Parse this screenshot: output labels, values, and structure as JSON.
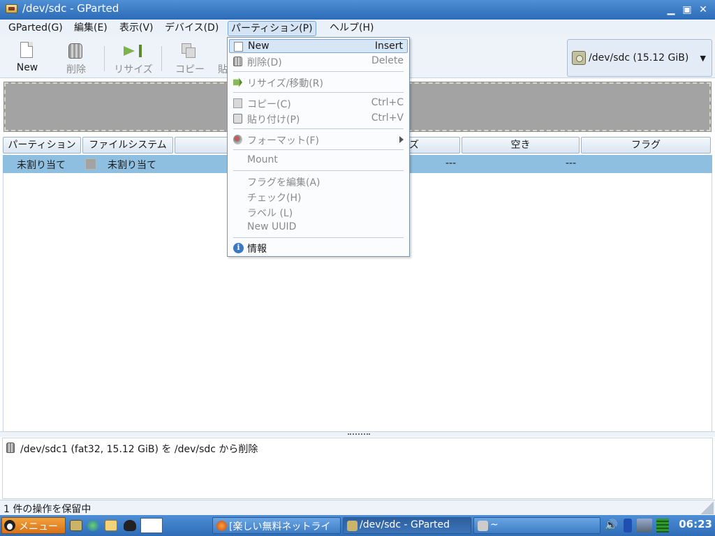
{
  "window": {
    "title": "/dev/sdc - GParted"
  },
  "menubar": {
    "items": [
      "GParted(G)",
      "編集(E)",
      "表示(V)",
      "デバイス(D)",
      "パーティション(P)",
      "ヘルプ(H)"
    ]
  },
  "toolbar": {
    "new_label": "New",
    "delete_label": "削除",
    "resize_label": "リサイズ",
    "copy_label": "コピー",
    "paste_label": "貼"
  },
  "device_selector": {
    "label": "/dev/sdc  (15.12 GiB)"
  },
  "columns": {
    "partition": "パーティション",
    "filesystem": "ファイルシステム",
    "size_partial": "ズ",
    "free": "空き",
    "flags": "フラグ"
  },
  "row": {
    "partition": "未割り当て",
    "filesystem": "未割り当て",
    "free": "---",
    "flags": "---"
  },
  "partition_menu": {
    "items": [
      {
        "label": "New",
        "shortcut": "Insert"
      },
      {
        "label": "削除(D)",
        "shortcut": "Delete"
      },
      {
        "label": "リサイズ/移動(R)",
        "shortcut": ""
      },
      {
        "label": "コピー(C)",
        "shortcut": "Ctrl+C"
      },
      {
        "label": "貼り付け(P)",
        "shortcut": "Ctrl+V"
      },
      {
        "label": "フォーマット(F)",
        "shortcut": ""
      },
      {
        "label": "Mount",
        "shortcut": ""
      },
      {
        "label": "フラグを編集(A)",
        "shortcut": ""
      },
      {
        "label": "チェック(H)",
        "shortcut": ""
      },
      {
        "label": "ラベル (L)",
        "shortcut": ""
      },
      {
        "label": "New UUID",
        "shortcut": ""
      },
      {
        "label": "情報",
        "shortcut": ""
      }
    ]
  },
  "pending_ops": {
    "items": [
      "/dev/sdc1 (fat32, 15.12 GiB) を /dev/sdc から削除"
    ]
  },
  "status": {
    "text": "1 件の操作を保留中"
  },
  "taskbar": {
    "start_label": "メニュー",
    "tasks": [
      "[楽しい無料ネットライ",
      "/dev/sdc - GParted",
      "~"
    ],
    "clock": "06:23"
  },
  "icons": {
    "app": "gparted-icon",
    "minimize": "minimize-icon",
    "maximize": "maximize-icon",
    "close": "close-icon",
    "new": "new-document-icon",
    "delete": "trash-icon",
    "resize": "resize-arrow-icon",
    "copy": "copy-icon",
    "device": "harddisk-icon",
    "info": "info-icon",
    "format": "format-icon"
  },
  "colors": {
    "titlebar": "#3d7ec8",
    "menu_highlight": "#d7e6f5",
    "selected_row": "#8fbfe0",
    "unallocated": "#a3a3a3",
    "taskbar": "#3e7dc6",
    "start_button": "#e4871f"
  }
}
